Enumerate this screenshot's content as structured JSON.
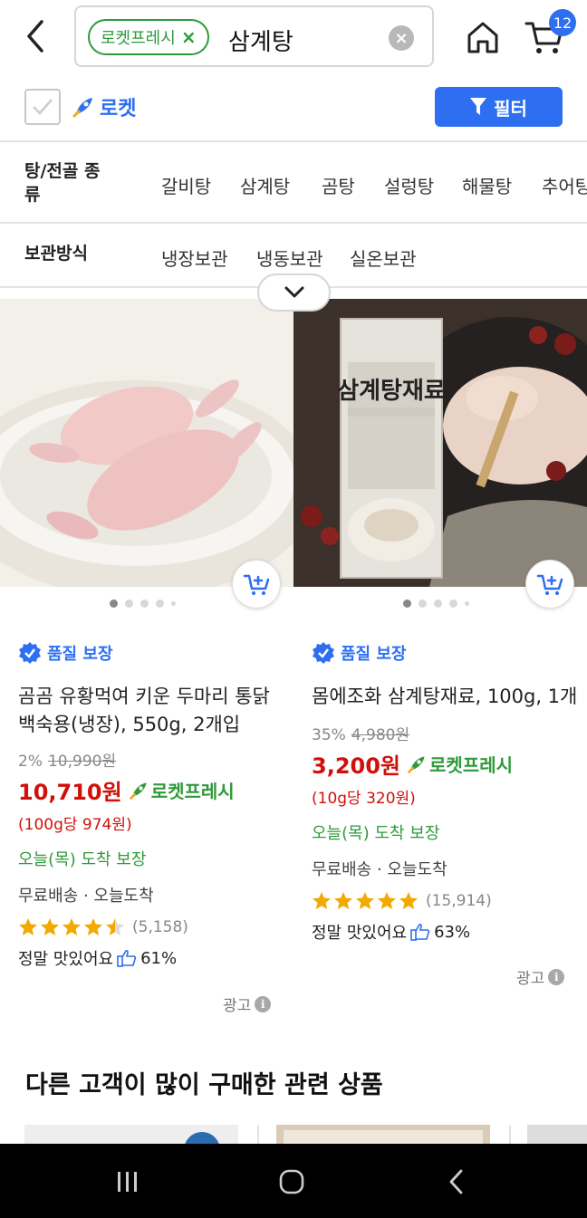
{
  "header": {
    "chip_label": "로켓프레시",
    "chip_close": "×",
    "query": "삼계탕",
    "cart_count": "12"
  },
  "rocket_filter": {
    "label": "로켓",
    "filter_button": "필터"
  },
  "filters": {
    "soup_type": {
      "title": "탕/전골 종류",
      "options": [
        "갈비탕",
        "삼계탕",
        "곰탕",
        "설렁탕",
        "해물탕",
        "추어탕"
      ]
    },
    "storage": {
      "title": "보관방식",
      "options": [
        "냉장보관",
        "냉동보관",
        "실온보관"
      ]
    }
  },
  "products": [
    {
      "quality": "품질 보장",
      "title": "곰곰 유황먹여 키운 두마리 통닭 백숙용(냉장), 550g, 2개입",
      "discount": "2%",
      "original_price": "10,990원",
      "price": "10,710원",
      "rocket": "로켓프레시",
      "unit_price": "(100g당 974원)",
      "arrival": "오늘(목) 도착 보장",
      "shipping": "무료배송 · 오늘도착",
      "rating": 4.5,
      "rating_count": "(5,158)",
      "review_text": "정말 맛있어요",
      "review_pct": "61%",
      "ad": "광고",
      "image_icon": "whole-chickens-photo"
    },
    {
      "quality": "품질 보장",
      "title": "몸에조화 삼계탕재료, 100g, 1개",
      "discount": "35%",
      "original_price": "4,980원",
      "price": "3,200원",
      "rocket": "로켓프레시",
      "unit_price": "(10g당 320원)",
      "arrival": "오늘(목) 도착 보장",
      "shipping": "무료배송 · 오늘도착",
      "rating": 5,
      "rating_count": "(15,914)",
      "review_text": "정말 맛있어요",
      "review_pct": "63%",
      "ad": "광고",
      "image_icon": "samgyetang-ingredients-package-photo",
      "package_text": "삼계탕재료"
    }
  ],
  "related": {
    "title": "다른 고객이 많이 구매한 관련 상품"
  },
  "colors": {
    "rocket_blue": "#2e6ff2",
    "fresh_green": "#2e9a3a",
    "price_red": "#d0110a"
  }
}
